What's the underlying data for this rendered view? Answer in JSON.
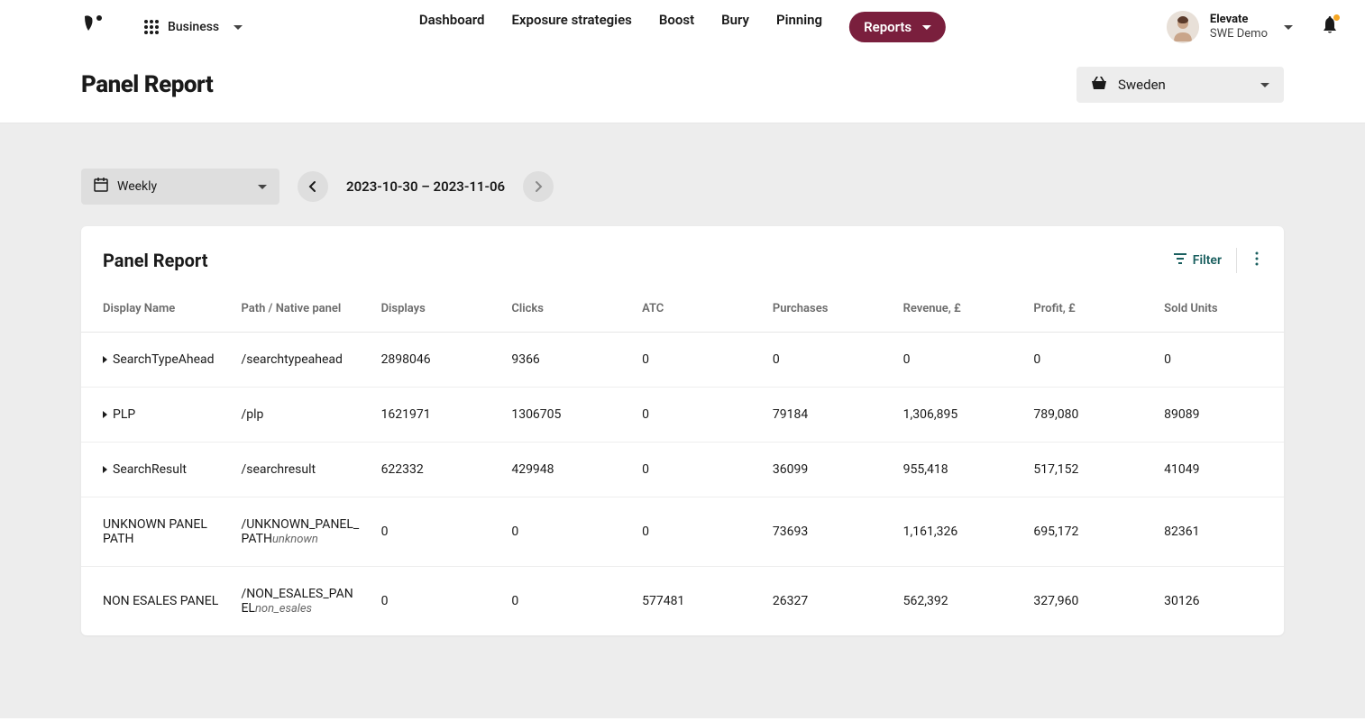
{
  "header": {
    "apps_label": "Business",
    "nav": [
      "Dashboard",
      "Exposure strategies",
      "Boost",
      "Bury",
      "Pinning",
      "Reports"
    ],
    "active_nav": "Reports",
    "user_name": "Elevate",
    "user_sub": "SWE Demo"
  },
  "subheader": {
    "title": "Panel Report",
    "market": "Sweden"
  },
  "controls": {
    "period": "Weekly",
    "date_range": "2023-10-30 – 2023-11-06"
  },
  "card": {
    "title": "Panel Report",
    "filter_label": "Filter",
    "columns": [
      "Display Name",
      "Path / Native panel",
      "Displays",
      "Clicks",
      "ATC",
      "Purchases",
      "Revenue, £",
      "Profit, £",
      "Sold Units"
    ],
    "rows": [
      {
        "expand": true,
        "name": "SearchTypeAhead",
        "path": "/searchtypeahead",
        "path_suffix": "",
        "displays": "2898046",
        "clicks": "9366",
        "atc": "0",
        "purchases": "0",
        "revenue": "0",
        "profit": "0",
        "sold": "0"
      },
      {
        "expand": true,
        "name": "PLP",
        "path": "/plp",
        "path_suffix": "",
        "displays": "1621971",
        "clicks": "1306705",
        "atc": "0",
        "purchases": "79184",
        "revenue": "1,306,895",
        "profit": "789,080",
        "sold": "89089"
      },
      {
        "expand": true,
        "name": "SearchResult",
        "path": "/searchresult",
        "path_suffix": "",
        "displays": "622332",
        "clicks": "429948",
        "atc": "0",
        "purchases": "36099",
        "revenue": "955,418",
        "profit": "517,152",
        "sold": "41049"
      },
      {
        "expand": false,
        "name": "UNKNOWN PANEL PATH",
        "path": "/UNKNOWN_PANEL_PATH",
        "path_suffix": "unknown",
        "displays": "0",
        "clicks": "0",
        "atc": "0",
        "purchases": "73693",
        "revenue": "1,161,326",
        "profit": "695,172",
        "sold": "82361"
      },
      {
        "expand": false,
        "name": "NON ESALES PANEL",
        "path": "/NON_ESALES_PANEL",
        "path_suffix": "non_esales",
        "displays": "0",
        "clicks": "0",
        "atc": "577481",
        "purchases": "26327",
        "revenue": "562,392",
        "profit": "327,960",
        "sold": "30126"
      }
    ]
  }
}
